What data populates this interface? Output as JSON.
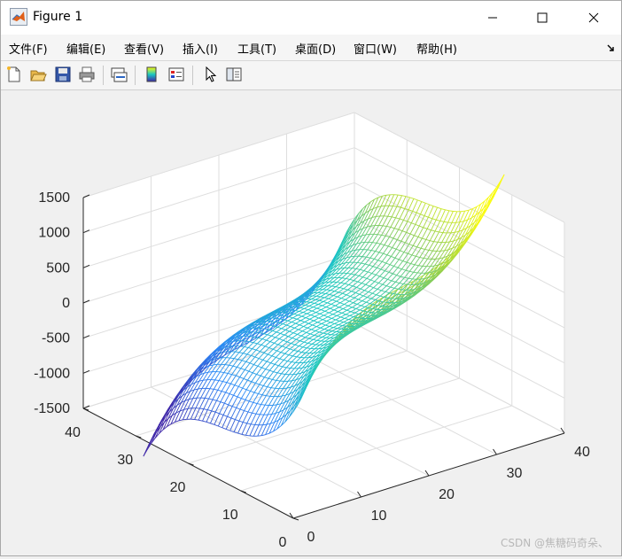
{
  "window": {
    "title": "Figure 1",
    "controls": {
      "minimize": "minimize-icon",
      "maximize": "maximize-icon",
      "close": "close-icon"
    }
  },
  "menu": {
    "items": [
      {
        "label": "文件(F)",
        "key": "F"
      },
      {
        "label": "编辑(E)",
        "key": "E"
      },
      {
        "label": "查看(V)",
        "key": "V"
      },
      {
        "label": "插入(I)",
        "key": "I"
      },
      {
        "label": "工具(T)",
        "key": "T"
      },
      {
        "label": "桌面(D)",
        "key": "D"
      },
      {
        "label": "窗口(W)",
        "key": "W"
      },
      {
        "label": "帮助(H)",
        "key": "H"
      }
    ],
    "dock_icon": "dock-arrow-icon"
  },
  "toolbar": {
    "buttons": [
      "new-figure-icon",
      "open-file-icon",
      "save-icon",
      "print-icon",
      "link-plot-icon",
      "insert-colorbar-icon",
      "insert-legend-icon",
      "edit-plot-icon",
      "property-editor-icon"
    ]
  },
  "chart_data": {
    "type": "mesh",
    "surface": "z = (x-20)^3 / 8 - (y-20)^3 / 8 style saddle-cubic mesh (colormap parula)",
    "xlim": [
      0,
      40
    ],
    "ylim": [
      0,
      40
    ],
    "zlim": [
      -1500,
      1500
    ],
    "x_ticks": [
      "0",
      "10",
      "20",
      "30",
      "40"
    ],
    "y_ticks": [
      "0",
      "10",
      "20",
      "30",
      "40"
    ],
    "z_ticks": [
      "1500",
      "1000",
      "500",
      "0",
      "-500",
      "-1000",
      "-1500"
    ],
    "grid": true,
    "colormap": [
      "#3e26a8",
      "#2e87f7",
      "#1ac7c2",
      "#8ccc53",
      "#f9fb0e"
    ]
  },
  "watermark": "CSDN @焦糖码奇朵、"
}
